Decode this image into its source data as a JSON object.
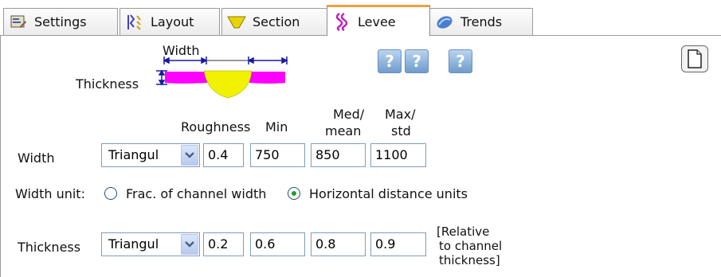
{
  "tabs": [
    {
      "label": "Settings",
      "icon": "settings-icon"
    },
    {
      "label": "Layout",
      "icon": "layout-icon"
    },
    {
      "label": "Section",
      "icon": "section-icon"
    },
    {
      "label": "Levee",
      "icon": "levee-icon",
      "active": true
    },
    {
      "label": "Trends",
      "icon": "trends-icon"
    }
  ],
  "diagram": {
    "width_label": "Width",
    "thickness_label": "Thickness"
  },
  "help_buttons": [
    "?",
    "?",
    "?"
  ],
  "columns": {
    "roughness": "Roughness",
    "min": "Min",
    "med_line1": "Med/",
    "med_line2": "mean",
    "max_line1": "Max/",
    "max_line2": "std"
  },
  "width_row": {
    "label": "Width",
    "distribution": "Triangul",
    "roughness": "0.4",
    "min": "750",
    "med": "850",
    "max": "1100"
  },
  "width_unit": {
    "label": "Width unit:",
    "options": [
      "Frac. of channel width",
      "Horizontal distance units"
    ],
    "selected": "Horizontal distance units"
  },
  "thickness_row": {
    "label": "Thickness",
    "distribution": "Triangul",
    "roughness": "0.2",
    "min": "0.6",
    "med": "0.8",
    "max": "0.9",
    "note_line1": "[Relative",
    "note_line2": "to channel",
    "note_line3": "thickness]"
  },
  "colors": {
    "levee_fill": "#ff00ff",
    "channel_fill": "#f2f200",
    "dimension_line": "#1a1aa0",
    "active_tab_accent": "#f0a040"
  }
}
